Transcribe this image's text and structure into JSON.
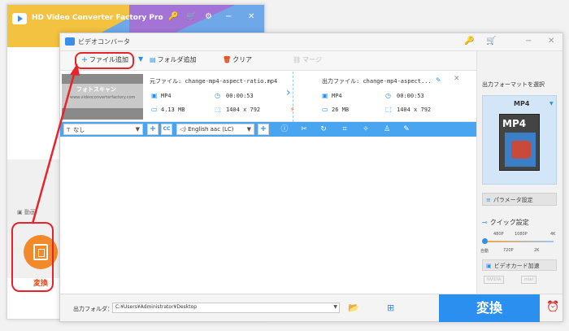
{
  "launcher": {
    "title": "HD Video Converter Factory Pro",
    "controls": [
      "🔑",
      "🛒",
      "⚙",
      "−",
      "✕"
    ],
    "video_label": "▣ 動画",
    "convert_label": "変換"
  },
  "main": {
    "title": "ビデオコンバータ",
    "title_controls": [
      "🔑",
      "🛒",
      "−",
      "✕"
    ],
    "toolbar": {
      "add_file": "ファイル追加",
      "add_folder": "フォルダ追加",
      "clear": "クリア",
      "merge": "マージ"
    },
    "file": {
      "thumb_text": "フォトスキャン",
      "thumb_sub": "www.videoconverterfactory.com",
      "source_label": "元ファイル:",
      "source_name": "change-mp4-aspect-ratio.mp4",
      "source_format": "MP4",
      "source_duration": "00:00:53",
      "source_size": "4.13 MB",
      "source_resolution": "1404 x 792",
      "output_label": "出力ファイル:",
      "output_name": "change-mp4-aspect...",
      "output_format": "MP4",
      "output_duration": "00:00:53",
      "output_size": "26 MB",
      "output_resolution": "1404 x 792"
    },
    "subbar": {
      "subtitle_value": "なし",
      "cc_label": "CC",
      "audio_value": "English aac (LC)"
    },
    "right": {
      "title": "出力フォーマットを選択",
      "format": "MP4",
      "format_icon_label": "MP4",
      "param_button": "パラメータ設定",
      "quick_title": "クイック設定",
      "quick_top": [
        "480P",
        "1080P",
        "4K"
      ],
      "quick_bottom": [
        "自動",
        "720P",
        "2K"
      ],
      "gpu_button": "ビデオカード加速",
      "vendors": [
        "NVIDIA",
        "intel"
      ]
    },
    "bottom": {
      "output_folder_label": "出力フォルダ：",
      "output_folder_value": "C:¥Users¥Administrator¥Desktop",
      "convert_button": "変換"
    }
  },
  "colors": {
    "accent": "#2b8ff0",
    "annotation": "#e8232b",
    "convert_orange": "#f28a2c"
  }
}
